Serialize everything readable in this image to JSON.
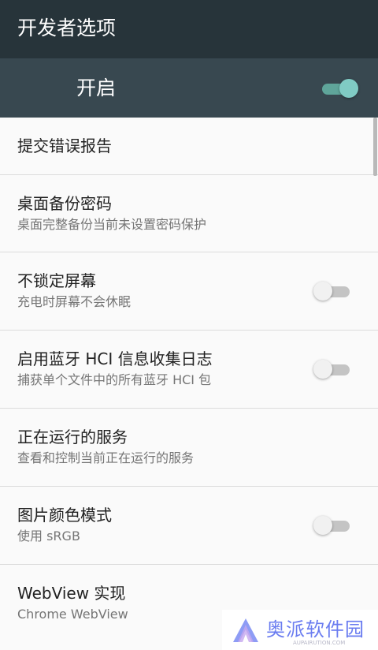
{
  "appbar": {
    "title": "开发者选项"
  },
  "master": {
    "label": "开启",
    "enabled": true
  },
  "items": [
    {
      "title": "提交错误报告",
      "subtitle": ""
    },
    {
      "title": "桌面备份密码",
      "subtitle": "桌面完整备份当前未设置密码保护"
    },
    {
      "title": "不锁定屏幕",
      "subtitle": "充电时屏幕不会休眠",
      "toggle": false
    },
    {
      "title": "启用蓝牙 HCI 信息收集日志",
      "subtitle": "捕获单个文件中的所有蓝牙 HCI 包",
      "toggle": false
    },
    {
      "title": "正在运行的服务",
      "subtitle": "查看和控制当前正在运行的服务"
    },
    {
      "title": "图片颜色模式",
      "subtitle": "使用 sRGB",
      "toggle": false
    },
    {
      "title": "WebView 实现",
      "subtitle": "Chrome WebView"
    }
  ],
  "watermark": {
    "text": "奥派软件园",
    "sub": "AUPAIRUTION.COM"
  },
  "colors": {
    "appbar": "#27343a",
    "master": "#384850",
    "accent": "#80cbc4"
  }
}
